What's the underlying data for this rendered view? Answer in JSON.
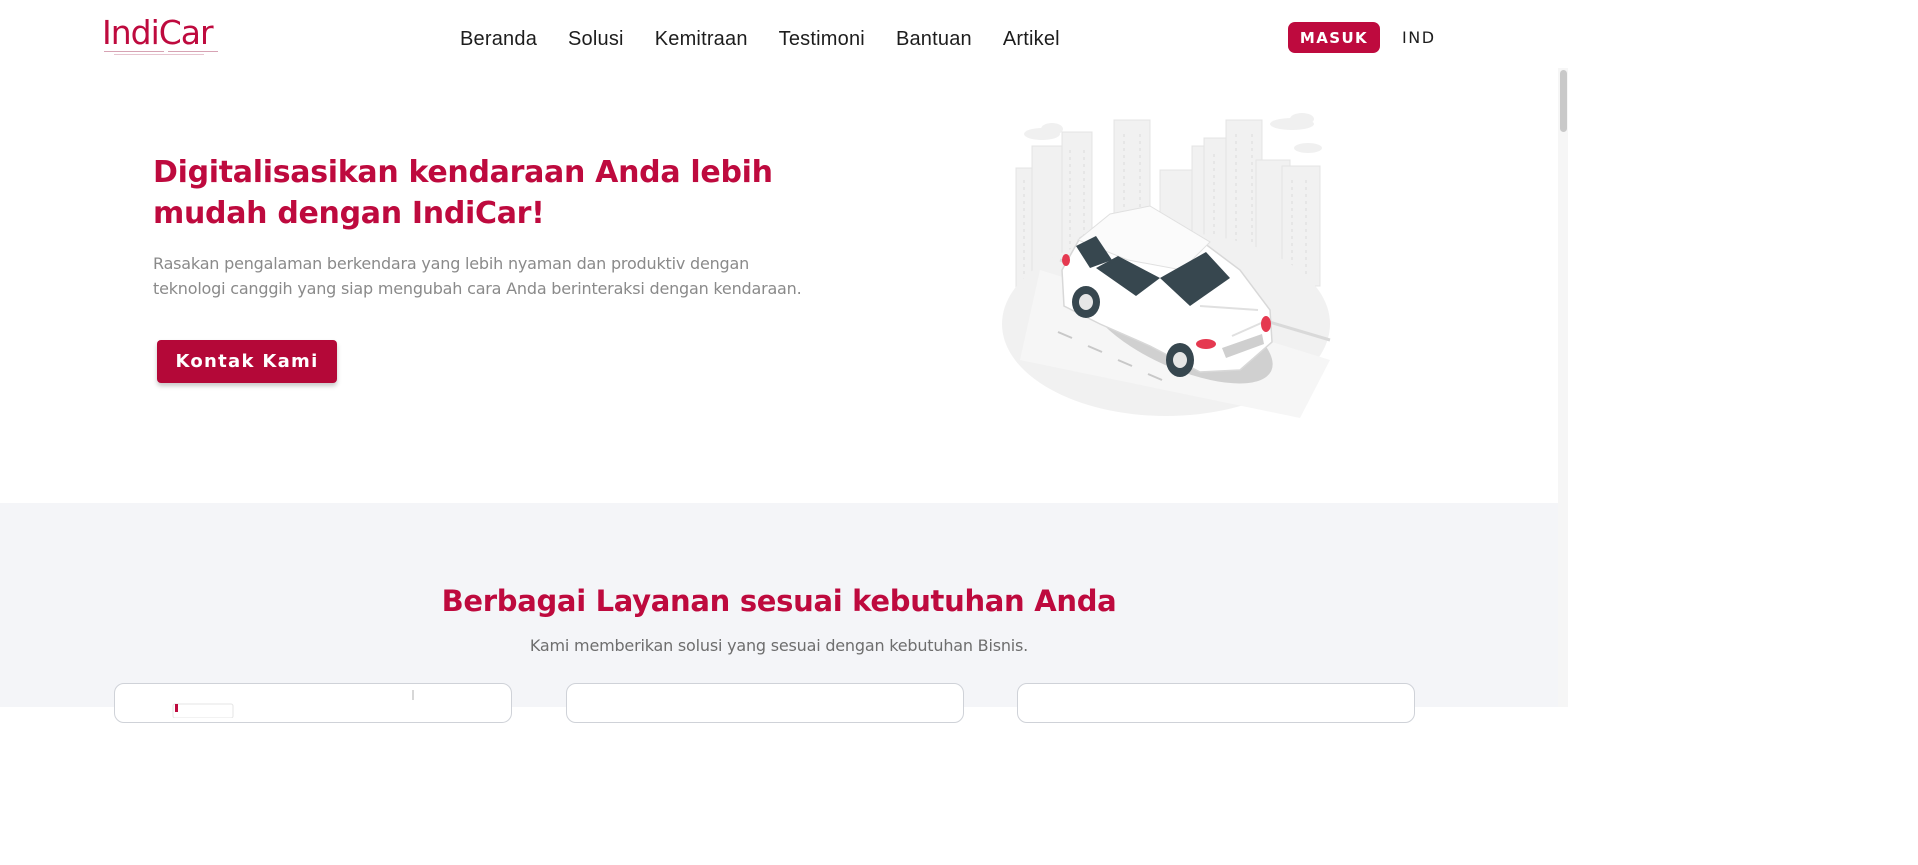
{
  "brand": {
    "logo_text": "IndiCar",
    "accent_color": "#be0a3e"
  },
  "nav": {
    "items": [
      {
        "label": "Beranda"
      },
      {
        "label": "Solusi"
      },
      {
        "label": "Kemitraan"
      },
      {
        "label": "Testimoni"
      },
      {
        "label": "Bantuan"
      },
      {
        "label": "Artikel"
      }
    ],
    "login_label": "MASUK",
    "language": "IND"
  },
  "hero": {
    "title_line1": "Digitalisasikan kendaraan Anda lebih",
    "title_line2": "mudah dengan IndiCar!",
    "subtitle_line1": "Rasakan pengalaman berkendara yang lebih nyaman dan produktiv dengan",
    "subtitle_line2": "teknologi canggih yang siap mengubah cara Anda berinteraksi dengan kendaraan.",
    "cta_label": "Kontak Kami",
    "illustration_icon": "car-city-illustration"
  },
  "services": {
    "title": "Berbagai Layanan sesuai kebutuhan Anda",
    "subtitle": "Kami memberikan solusi yang sesuai dengan kebutuhan Bisnis.",
    "cards_visible": 3
  }
}
